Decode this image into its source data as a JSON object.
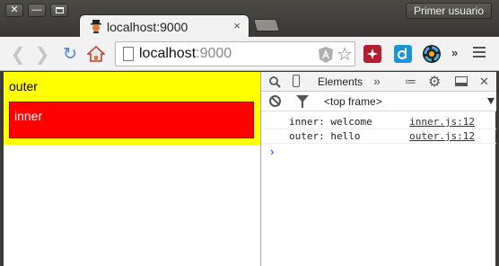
{
  "window": {
    "profile_label": "Primer usuario",
    "close_glyph": "✕",
    "min_glyph": "—"
  },
  "tab": {
    "title": "localhost:9000",
    "close_glyph": "×"
  },
  "toolbar": {
    "url_host": "localhost",
    "url_port": ":9000",
    "back_glyph": "❮",
    "forward_glyph": "❯",
    "reload_glyph": "↻",
    "star_glyph": "☆",
    "more_glyph": "»"
  },
  "page": {
    "outer_label": "outer",
    "inner_label": "inner",
    "colors": {
      "outer": "#ffff00",
      "inner": "#ff0000"
    }
  },
  "devtools": {
    "tab_elements": "Elements",
    "more_tabs_glyph": "»",
    "frame_select": "<top frame>",
    "logs": [
      {
        "message": "inner: welcome",
        "source": "inner.js:12"
      },
      {
        "message": "outer: hello",
        "source": "outer.js:12"
      }
    ],
    "prompt_glyph": "›",
    "close_glyph": "✕",
    "gear_glyph": "⚙",
    "drawer_glyph": "≔",
    "inspect_glyph": "🔍"
  }
}
